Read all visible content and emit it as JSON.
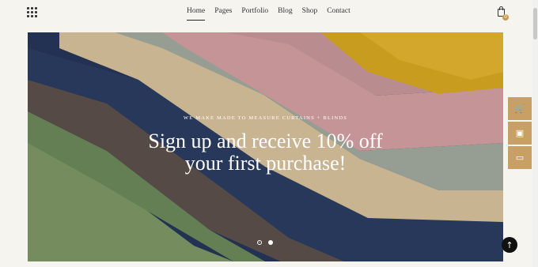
{
  "header": {
    "menu_icon": "grid-icon",
    "nav": [
      {
        "label": "Home",
        "active": true
      },
      {
        "label": "Pages",
        "active": false
      },
      {
        "label": "Portfolio",
        "active": false
      },
      {
        "label": "Blog",
        "active": false
      },
      {
        "label": "Shop",
        "active": false
      },
      {
        "label": "Contact",
        "active": false
      }
    ],
    "cart_icon": "shopping-bag-icon",
    "cart_count": "0"
  },
  "hero": {
    "eyebrow": "WE MAKE MADE TO MEASURE CURTAINS + BLINDS",
    "headline_line1": "Sign up and receive 10% off",
    "headline_line2": "your first purchase!",
    "slides_total": 2,
    "active_slide": 1
  },
  "side_panel": {
    "buttons": [
      {
        "icon": "cart-icon",
        "glyph": "🛒"
      },
      {
        "icon": "gift-card-icon",
        "glyph": "▣"
      },
      {
        "icon": "window-icon",
        "glyph": "▭"
      }
    ]
  },
  "back_to_top": {
    "icon": "arrow-up-icon",
    "glyph": "↑"
  },
  "colors": {
    "accent": "#c8a065",
    "background": "#f6f4ee"
  }
}
